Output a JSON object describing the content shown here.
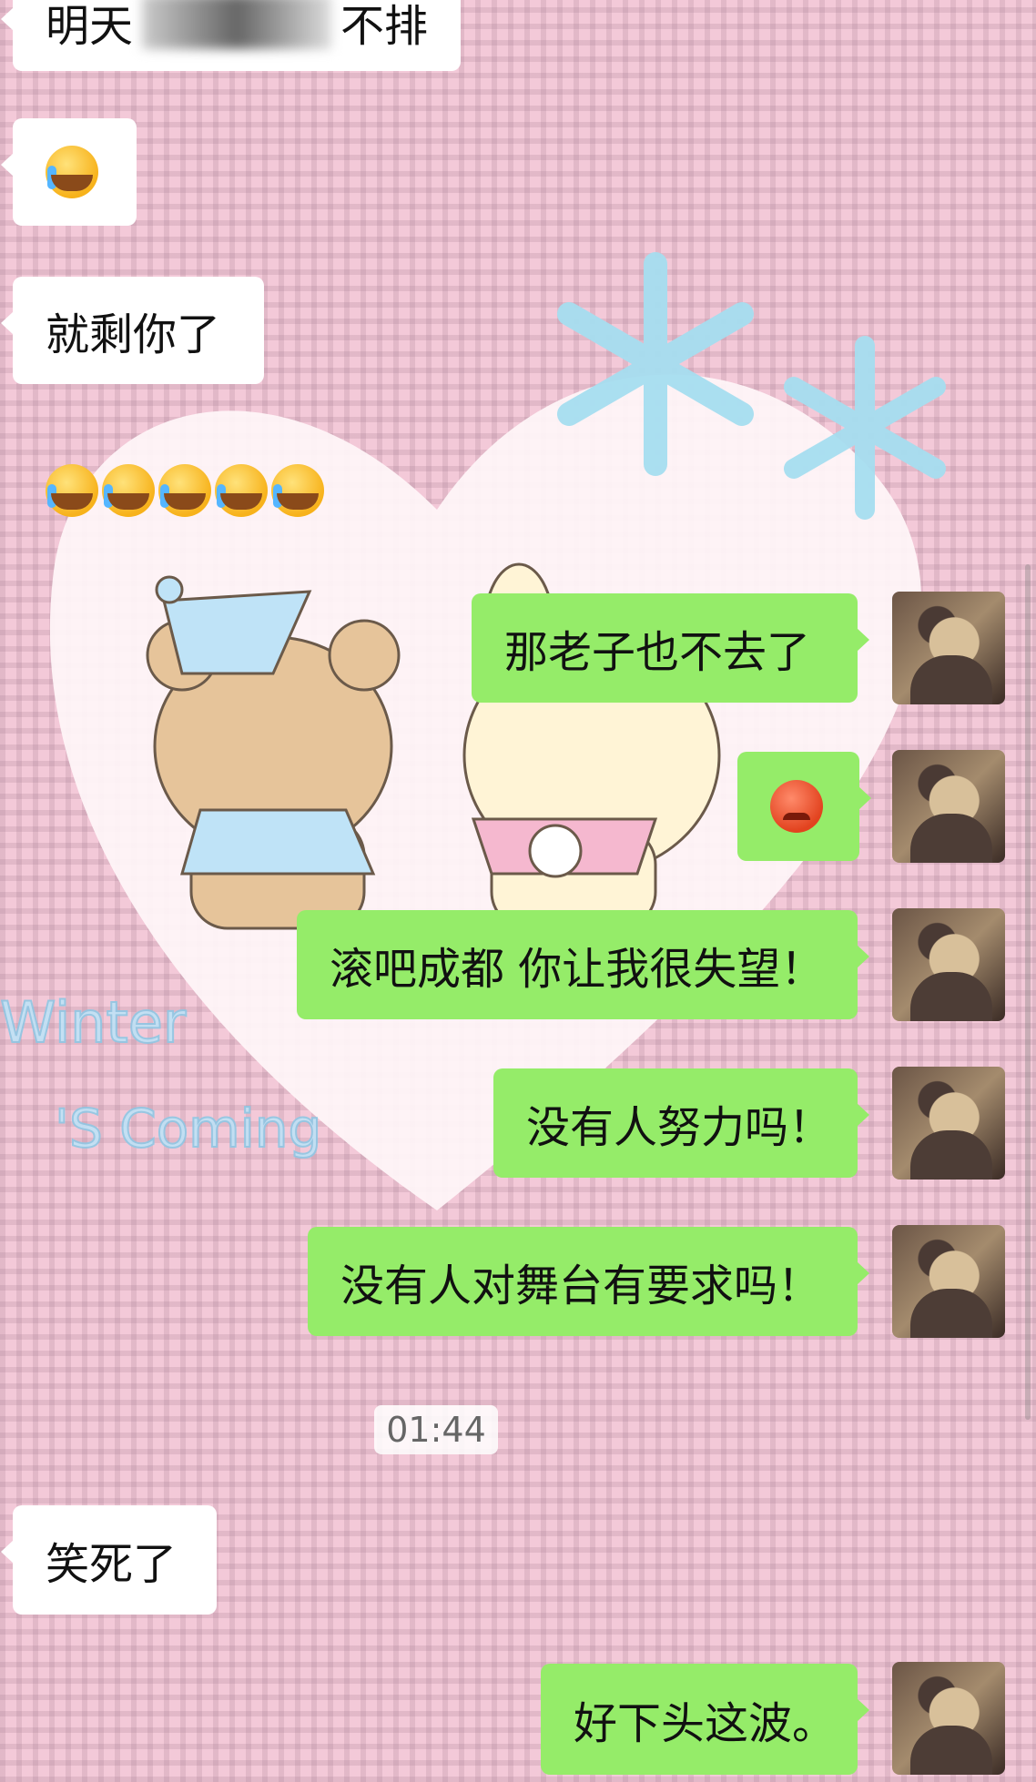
{
  "chat": {
    "messages": [
      {
        "direction": "in",
        "text": "明天",
        "blurred": true,
        "suffix": "不排"
      },
      {
        "direction": "in",
        "emojis": [
          "loudly-crying-face"
        ]
      },
      {
        "direction": "in",
        "text": "就剩你了"
      },
      {
        "direction": "in",
        "emojis": [
          "loudly-crying-face",
          "loudly-crying-face",
          "loudly-crying-face",
          "loudly-crying-face",
          "loudly-crying-face"
        ],
        "plain": true
      },
      {
        "direction": "out",
        "text": "那老子也不去了"
      },
      {
        "direction": "out",
        "emojis": [
          "angry-face"
        ]
      },
      {
        "direction": "out",
        "text": "滚吧成都 你让我很失望！"
      },
      {
        "direction": "out",
        "text": "没有人努力吗！"
      },
      {
        "direction": "out",
        "text": "没有人对舞台有要求吗！"
      },
      {
        "direction": "in",
        "text": "笑死了"
      },
      {
        "direction": "out",
        "text": "好下头这波。"
      }
    ],
    "timestamp": "01:44"
  },
  "background": {
    "decor_text_1": "Winter",
    "decor_text_2": "'S Coming"
  },
  "colors": {
    "out_bubble": "#95ec69",
    "in_bubble": "#ffffff",
    "background": "#f3c9d8"
  }
}
